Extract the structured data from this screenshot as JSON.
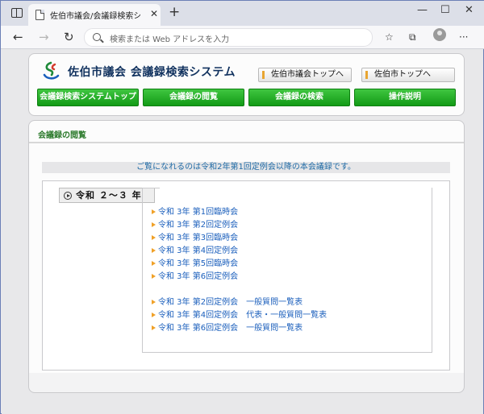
{
  "browser": {
    "tab_title": "佐伯市議会/会議録検索システム",
    "address_placeholder": "検索または Web アドレスを入力"
  },
  "header": {
    "site_title": "佐伯市議会 会議録検索システム",
    "link_buttons": [
      {
        "label": "佐伯市議会トップへ"
      },
      {
        "label": "佐伯市トップへ"
      }
    ],
    "nav_tabs": [
      {
        "label": "会議録検索システムトップ"
      },
      {
        "label": "会議録の閲覧"
      },
      {
        "label": "会議録の検索"
      },
      {
        "label": "操作説明"
      }
    ]
  },
  "content": {
    "section_title": "会議録の閲覧",
    "notice": "ご覧になれるのは令和2年第1回定例会以降の本会議録です。",
    "year_label": "令和 ２～３ 年",
    "entries": [
      {
        "label": "令和 3年 第1回臨時会"
      },
      {
        "label": "令和 3年 第2回定例会"
      },
      {
        "label": "令和 3年 第3回臨時会"
      },
      {
        "label": "令和 3年 第4回定例会"
      },
      {
        "label": "令和 3年 第5回臨時会"
      },
      {
        "label": "令和 3年 第6回定例会"
      },
      {
        "label": "令和 3年 第2回定例会　一般質問一覧表"
      },
      {
        "label": "令和 3年 第4回定例会　代表・一般質問一覧表"
      },
      {
        "label": "令和 3年 第6回定例会　一般質問一覧表"
      }
    ]
  },
  "colors": {
    "nav_green": "#129a16",
    "link_blue": "#1b5fbc",
    "section_green": "#2b7a2b",
    "title_navy": "#10315e",
    "arrow_orange": "#f0a128"
  }
}
